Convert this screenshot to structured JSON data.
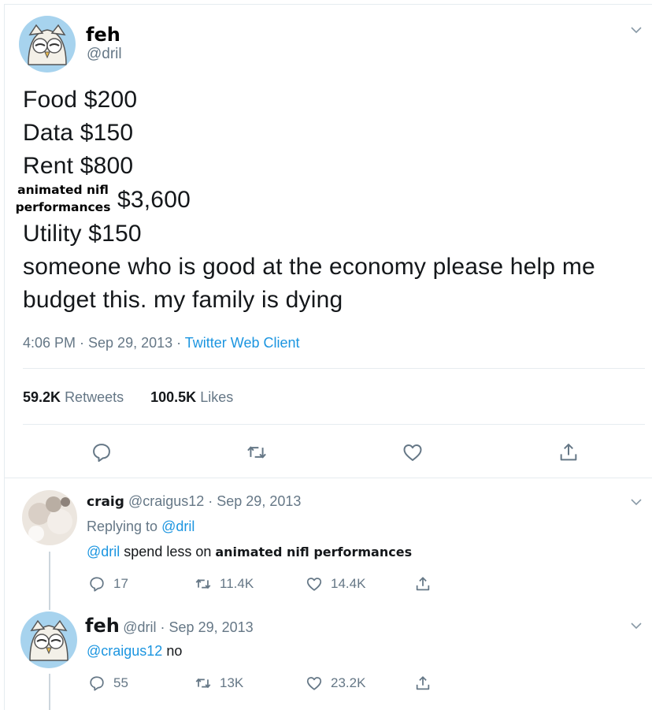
{
  "main_tweet": {
    "display_name": "feh",
    "handle": "@dril",
    "lines": [
      "Food $200",
      "Data $150",
      "Rent $800"
    ],
    "meme_label_line1": "animated nifl",
    "meme_label_line2": "performances",
    "meme_amount": "$3,600",
    "line_utility": "Utility $150",
    "line_plea1": "someone who is good at the economy please help me",
    "line_plea2": "budget this. my family is dying",
    "timestamp": "4:06 PM · Sep 29, 2013 · ",
    "client": "Twitter Web Client",
    "retweets_count": "59.2K",
    "retweets_label": "Retweets",
    "likes_count": "100.5K",
    "likes_label": "Likes"
  },
  "reply1": {
    "display_name": "craig",
    "handle_date": "@craigus12 · Sep 29, 2013",
    "replying_to_label": "Replying to ",
    "replying_to_handle": "@dril",
    "mention": "@dril",
    "text": " spend less on ",
    "meme_text": "animated nifl performances",
    "replies": "17",
    "retweets": "11.4K",
    "likes": "14.4K"
  },
  "reply2": {
    "display_name": "feh",
    "handle_date": "@dril · Sep 29, 2013",
    "mention": "@craigus12",
    "text": " no",
    "replies": "55",
    "retweets": "13K",
    "likes": "23.2K"
  },
  "icons": [
    "owl-avatar",
    "chevron-down-icon",
    "reply-icon",
    "retweet-icon",
    "like-icon",
    "share-icon"
  ],
  "colors": {
    "link": "#1b95e0",
    "muted": "#657786",
    "divider": "#e6ecf0"
  }
}
